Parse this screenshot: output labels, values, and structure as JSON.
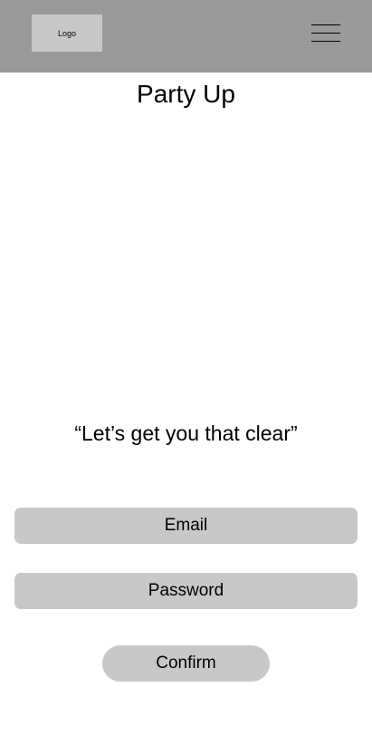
{
  "header": {
    "logo_label": "Logo",
    "menu_icon": "hamburger-menu-icon",
    "background_color": "#999999"
  },
  "main": {
    "title": "Party Up",
    "tagline": "“Let’s get you that clear”"
  },
  "form": {
    "email_label": "Email",
    "password_label": "Password",
    "confirm_label": "Confirm",
    "field_color": "#c8c8c8"
  }
}
